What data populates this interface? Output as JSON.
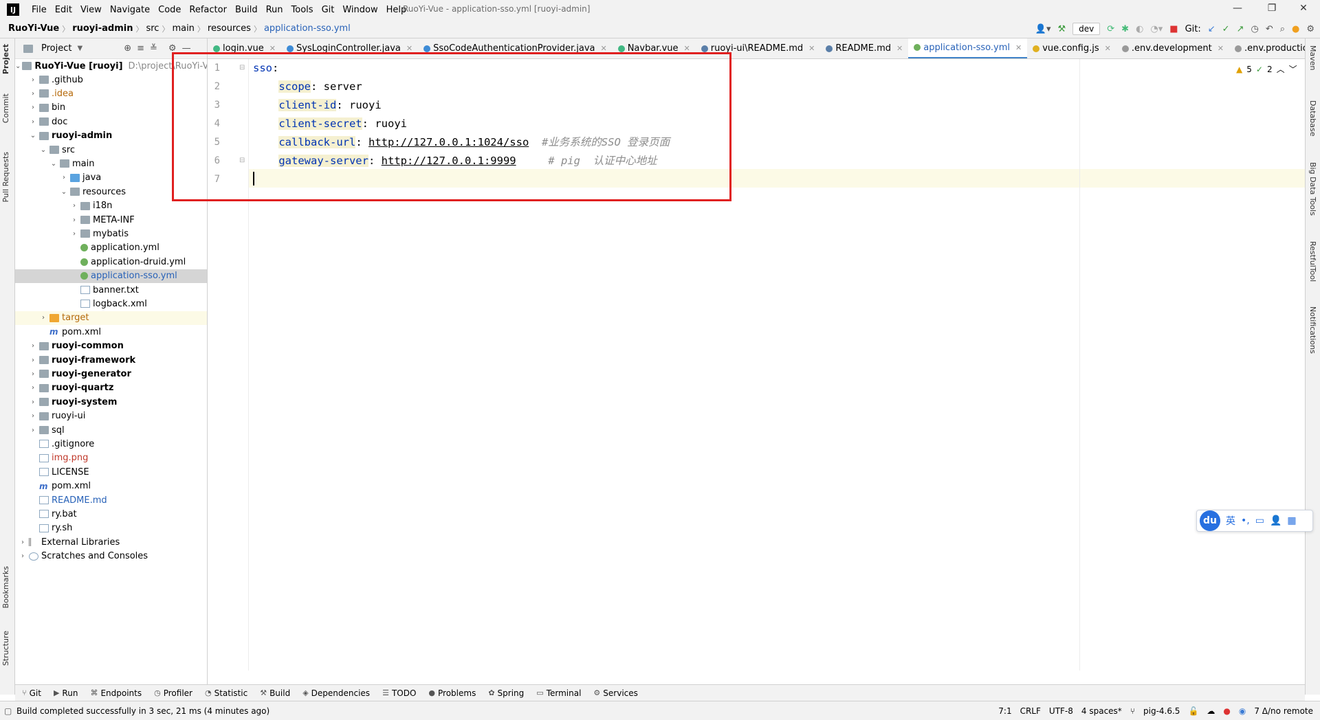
{
  "app": {
    "window_title": "RuoYi-Vue - application-sso.yml [ruoyi-admin]",
    "menu": [
      "File",
      "Edit",
      "View",
      "Navigate",
      "Code",
      "Refactor",
      "Build",
      "Run",
      "Tools",
      "Git",
      "Window",
      "Help"
    ]
  },
  "breadcrumb": [
    "RuoYi-Vue",
    "ruoyi-admin",
    "src",
    "main",
    "resources",
    "application-sso.yml"
  ],
  "toolbar": {
    "branch_combo": "dev",
    "git_label": "Git:"
  },
  "project_panel": {
    "title": "Project",
    "root_label": "RuoYi-Vue [ruoyi]",
    "root_path": "D:\\project\\RuoYi-Vue",
    "tree": [
      {
        "label": ".github",
        "depth": 1,
        "icon": "folder",
        "arrow": "›"
      },
      {
        "label": ".idea",
        "depth": 1,
        "icon": "folder",
        "arrow": "›",
        "style": "idea"
      },
      {
        "label": "bin",
        "depth": 1,
        "icon": "folder",
        "arrow": "›"
      },
      {
        "label": "doc",
        "depth": 1,
        "icon": "folder",
        "arrow": "›"
      },
      {
        "label": "ruoyi-admin",
        "depth": 1,
        "icon": "folder",
        "arrow": "⌄",
        "style": "bold"
      },
      {
        "label": "src",
        "depth": 2,
        "icon": "folder",
        "arrow": "⌄"
      },
      {
        "label": "main",
        "depth": 3,
        "icon": "folder",
        "arrow": "⌄"
      },
      {
        "label": "java",
        "depth": 4,
        "icon": "folder-blue",
        "arrow": "›"
      },
      {
        "label": "resources",
        "depth": 4,
        "icon": "folder",
        "arrow": "⌄"
      },
      {
        "label": "i18n",
        "depth": 5,
        "icon": "folder",
        "arrow": "›"
      },
      {
        "label": "META-INF",
        "depth": 5,
        "icon": "folder",
        "arrow": "›"
      },
      {
        "label": "mybatis",
        "depth": 5,
        "icon": "folder",
        "arrow": "›"
      },
      {
        "label": "application.yml",
        "depth": 5,
        "icon": "yml",
        "arrow": ""
      },
      {
        "label": "application-druid.yml",
        "depth": 5,
        "icon": "yml",
        "arrow": ""
      },
      {
        "label": "application-sso.yml",
        "depth": 5,
        "icon": "yml",
        "arrow": "",
        "style": "selected"
      },
      {
        "label": "banner.txt",
        "depth": 5,
        "icon": "file",
        "arrow": ""
      },
      {
        "label": "logback.xml",
        "depth": 5,
        "icon": "file",
        "arrow": ""
      },
      {
        "label": "target",
        "depth": 2,
        "icon": "folder-orange",
        "arrow": "›",
        "style": "target"
      },
      {
        "label": "pom.xml",
        "depth": 2,
        "icon": "m",
        "arrow": ""
      },
      {
        "label": "ruoyi-common",
        "depth": 1,
        "icon": "folder",
        "arrow": "›",
        "style": "bold"
      },
      {
        "label": "ruoyi-framework",
        "depth": 1,
        "icon": "folder",
        "arrow": "›",
        "style": "bold"
      },
      {
        "label": "ruoyi-generator",
        "depth": 1,
        "icon": "folder",
        "arrow": "›",
        "style": "bold"
      },
      {
        "label": "ruoyi-quartz",
        "depth": 1,
        "icon": "folder",
        "arrow": "›",
        "style": "bold"
      },
      {
        "label": "ruoyi-system",
        "depth": 1,
        "icon": "folder",
        "arrow": "›",
        "style": "bold"
      },
      {
        "label": "ruoyi-ui",
        "depth": 1,
        "icon": "folder",
        "arrow": "›"
      },
      {
        "label": "sql",
        "depth": 1,
        "icon": "folder",
        "arrow": "›"
      },
      {
        "label": ".gitignore",
        "depth": 1,
        "icon": "file",
        "arrow": ""
      },
      {
        "label": "img.png",
        "depth": 1,
        "icon": "file",
        "arrow": "",
        "style": "red"
      },
      {
        "label": "LICENSE",
        "depth": 1,
        "icon": "file",
        "arrow": ""
      },
      {
        "label": "pom.xml",
        "depth": 1,
        "icon": "m",
        "arrow": ""
      },
      {
        "label": "README.md",
        "depth": 1,
        "icon": "file",
        "arrow": "",
        "style": "blue"
      },
      {
        "label": "ry.bat",
        "depth": 1,
        "icon": "file",
        "arrow": ""
      },
      {
        "label": "ry.sh",
        "depth": 1,
        "icon": "file",
        "arrow": ""
      },
      {
        "label": "External Libraries",
        "depth": 0,
        "icon": "lib",
        "arrow": "›"
      },
      {
        "label": "Scratches and Consoles",
        "depth": 0,
        "icon": "scratch",
        "arrow": "›"
      }
    ]
  },
  "left_tool_tabs": [
    "Project",
    "Commit",
    "Pull Requests",
    "Bookmarks",
    "Structure"
  ],
  "right_tool_tabs": [
    "Maven",
    "Database",
    "Big Data Tools",
    "RestfulTool",
    "Notifications"
  ],
  "editor_tabs": [
    {
      "label": "login.vue",
      "color": "#41b883"
    },
    {
      "label": "SysLoginController.java",
      "color": "#3d8bd6"
    },
    {
      "label": "SsoCodeAuthenticationProvider.java",
      "color": "#3d8bd6"
    },
    {
      "label": "Navbar.vue",
      "color": "#41b883"
    },
    {
      "label": "ruoyi-ui\\README.md",
      "color": "#5a7ea8"
    },
    {
      "label": "README.md",
      "color": "#5a7ea8"
    },
    {
      "label": "application-sso.yml",
      "color": "#6fb05c",
      "active": true
    },
    {
      "label": "vue.config.js",
      "color": "#e0b020"
    },
    {
      "label": ".env.development",
      "color": "#999999"
    },
    {
      "label": ".env.production",
      "color": "#999999"
    }
  ],
  "editor": {
    "line_numbers": [
      "1",
      "2",
      "3",
      "4",
      "5",
      "6",
      "7"
    ],
    "lines": [
      {
        "key": "sso",
        "sep": ":",
        "value": "",
        "comment": "",
        "indent": false
      },
      {
        "key": "scope",
        "sep": ": ",
        "value": "server",
        "comment": "",
        "indent": true
      },
      {
        "key": "client-id",
        "sep": ": ",
        "value": "ruoyi",
        "comment": "",
        "indent": true
      },
      {
        "key": "client-secret",
        "sep": ": ",
        "value": "ruoyi",
        "comment": "",
        "indent": true
      },
      {
        "key": "callback-url",
        "sep": ": ",
        "value": "http://127.0.0.1:1024/sso",
        "comment": "  #业务系统的SSO 登录页面",
        "indent": true,
        "url": true
      },
      {
        "key": "gateway-server",
        "sep": ": ",
        "value": "http://127.0.0.1:9999",
        "comment": "     # pig  认证中心地址",
        "indent": true,
        "url": true
      }
    ],
    "inspection": {
      "warnings": "5",
      "weak_warnings": "2"
    }
  },
  "ime_toolbar": {
    "logo": "du",
    "lang": "英",
    "punct": "•,"
  },
  "bottom_tools": [
    "Git",
    "Run",
    "Endpoints",
    "Profiler",
    "Statistic",
    "Build",
    "Dependencies",
    "TODO",
    "Problems",
    "Spring",
    "Terminal",
    "Services"
  ],
  "status": {
    "message": "Build completed successfully in 3 sec, 21 ms (4 minutes ago)",
    "position": "7:1",
    "line_sep": "CRLF",
    "encoding": "UTF-8",
    "indent": "4 spaces*",
    "branch": "pig-4.6.5",
    "remote": "7 Δ/no remote"
  }
}
